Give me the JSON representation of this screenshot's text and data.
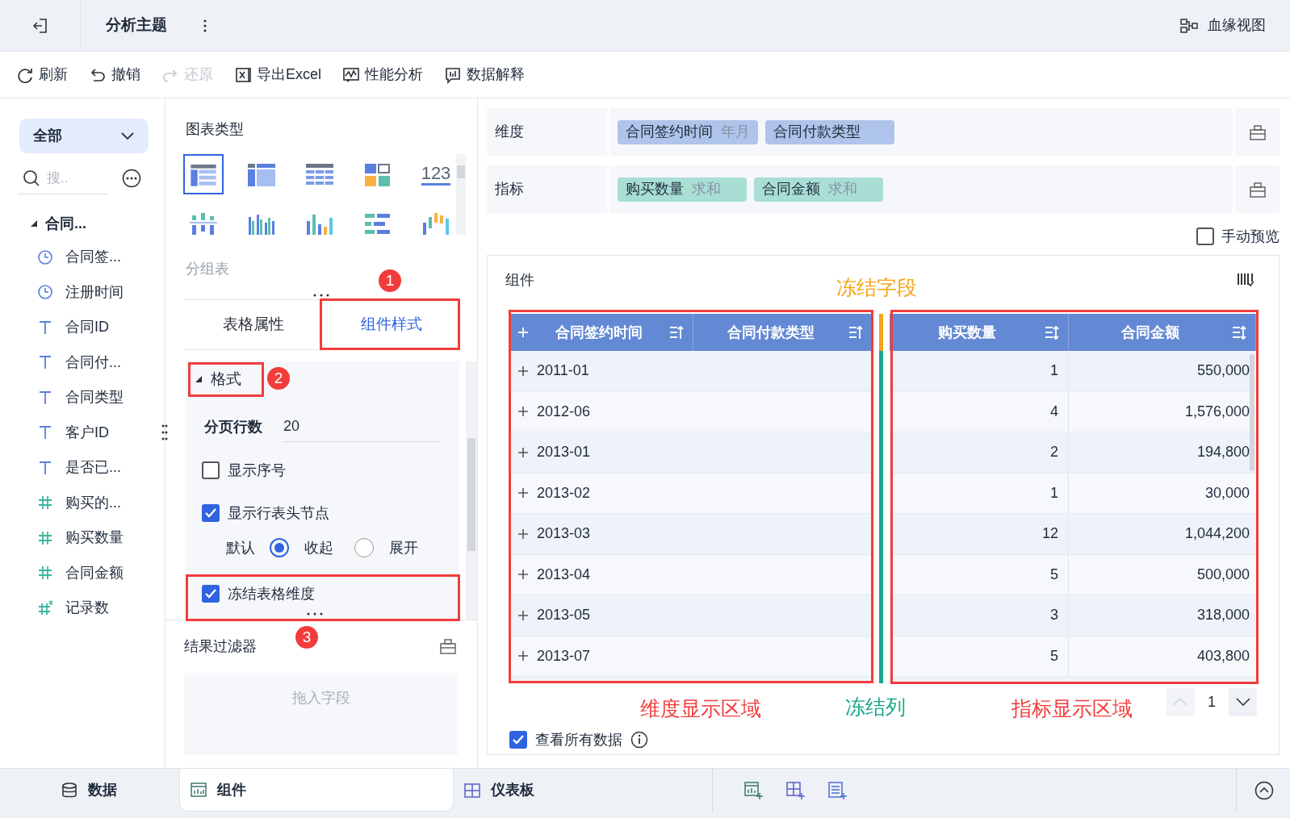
{
  "header": {
    "title": "分析主题",
    "lineage": "血缘视图"
  },
  "toolbar": [
    {
      "label": "刷新",
      "kind": "refresh",
      "disabled": false
    },
    {
      "label": "撤销",
      "kind": "undo",
      "disabled": false
    },
    {
      "label": "还原",
      "kind": "redo",
      "disabled": true
    },
    {
      "label": "导出Excel",
      "kind": "export",
      "disabled": false
    },
    {
      "label": "性能分析",
      "kind": "performance",
      "disabled": false
    },
    {
      "label": "数据解释",
      "kind": "explain",
      "disabled": false
    }
  ],
  "fields": {
    "scope": "全部",
    "search_placeholder": "搜..",
    "group": {
      "label": "合同...",
      "expanded": true,
      "children": [
        {
          "label": "合同签...",
          "kind": "date"
        },
        {
          "label": "注册时间",
          "kind": "date"
        },
        {
          "label": "合同ID",
          "kind": "text"
        },
        {
          "label": "合同付...",
          "kind": "text"
        },
        {
          "label": "合同类型",
          "kind": "text"
        },
        {
          "label": "客户ID",
          "kind": "text"
        },
        {
          "label": "是否已...",
          "kind": "text"
        },
        {
          "label": "购买的...",
          "kind": "number"
        },
        {
          "label": "购买数量",
          "kind": "number"
        },
        {
          "label": "合同金额",
          "kind": "number"
        },
        {
          "label": "记录数",
          "kind": "calc"
        }
      ]
    }
  },
  "chart_types": {
    "title": "图表类型",
    "current": "分组表",
    "items": [
      {
        "kind": "group-table",
        "selected": true
      },
      {
        "kind": "cross-table",
        "selected": false
      },
      {
        "kind": "detail-table",
        "selected": false
      },
      {
        "kind": "treemap",
        "selected": false
      },
      {
        "kind": "kpi",
        "label": "123",
        "selected": false
      },
      {
        "kind": "stacked-bar",
        "selected": false
      },
      {
        "kind": "grouped-bar",
        "selected": false
      },
      {
        "kind": "bar",
        "selected": false
      },
      {
        "kind": "horizontal-bar",
        "selected": false
      },
      {
        "kind": "range-bar",
        "selected": false
      }
    ]
  },
  "tabs": [
    {
      "label": "表格属性",
      "selected": false
    },
    {
      "label": "组件样式",
      "selected": true
    }
  ],
  "format": {
    "title": "格式",
    "expanded": true,
    "page_rows_label": "分页行数",
    "page_rows": "20",
    "options": [
      {
        "label": "显示序号",
        "checked": false
      },
      {
        "label": "显示行表头节点",
        "checked": true
      }
    ],
    "default_label": "默认",
    "radios": [
      {
        "label": "收起",
        "selected": true
      },
      {
        "label": "展开",
        "selected": false
      }
    ],
    "freeze": {
      "label": "冻结表格维度",
      "checked": true
    }
  },
  "filter": {
    "title": "结果过滤器",
    "placeholder": "拖入字段"
  },
  "dimensions": {
    "label": "维度",
    "chips": [
      {
        "name": "合同签约时间",
        "suffix": "年月"
      },
      {
        "name": "合同付款类型"
      }
    ]
  },
  "measures": {
    "label": "指标",
    "chips": [
      {
        "name": "购买数量",
        "suffix": "求和"
      },
      {
        "name": "合同金额",
        "suffix": "求和"
      }
    ]
  },
  "manual_preview": {
    "label": "手动预览",
    "checked": false
  },
  "widget": {
    "title": "组件",
    "columns": [
      {
        "label": "合同签约时间",
        "kind": "dimension"
      },
      {
        "label": "合同付款类型",
        "kind": "dimension"
      },
      {
        "label": "购买数量",
        "kind": "measure"
      },
      {
        "label": "合同金额",
        "kind": "measure"
      }
    ],
    "rows": [
      [
        "2011-01",
        "",
        "1",
        "550,000"
      ],
      [
        "2012-06",
        "",
        "4",
        "1,576,000"
      ],
      [
        "2013-01",
        "",
        "2",
        "194,800"
      ],
      [
        "2013-02",
        "",
        "1",
        "30,000"
      ],
      [
        "2013-03",
        "",
        "12",
        "1,044,200"
      ],
      [
        "2013-04",
        "",
        "5",
        "500,000"
      ],
      [
        "2013-05",
        "",
        "3",
        "318,000"
      ],
      [
        "2013-07",
        "",
        "5",
        "403,800"
      ]
    ],
    "page": "1",
    "view_all": {
      "label": "查看所有数据",
      "checked": true
    }
  },
  "markers": [
    "1",
    "2",
    "3"
  ],
  "labels": [
    {
      "text": "冻结字段",
      "color": "#f5a316"
    },
    {
      "text": "维度显示区域",
      "color": "#f23c3c"
    },
    {
      "text": "冻结列",
      "color": "#17a88a"
    },
    {
      "text": "指标显示区域",
      "color": "#f23c3c"
    }
  ],
  "bottom_tabs": [
    {
      "label": "数据",
      "kind": "data",
      "selected": false
    },
    {
      "label": "组件",
      "kind": "widget",
      "selected": true
    },
    {
      "label": "仪表板",
      "kind": "dashboard",
      "selected": false
    }
  ]
}
